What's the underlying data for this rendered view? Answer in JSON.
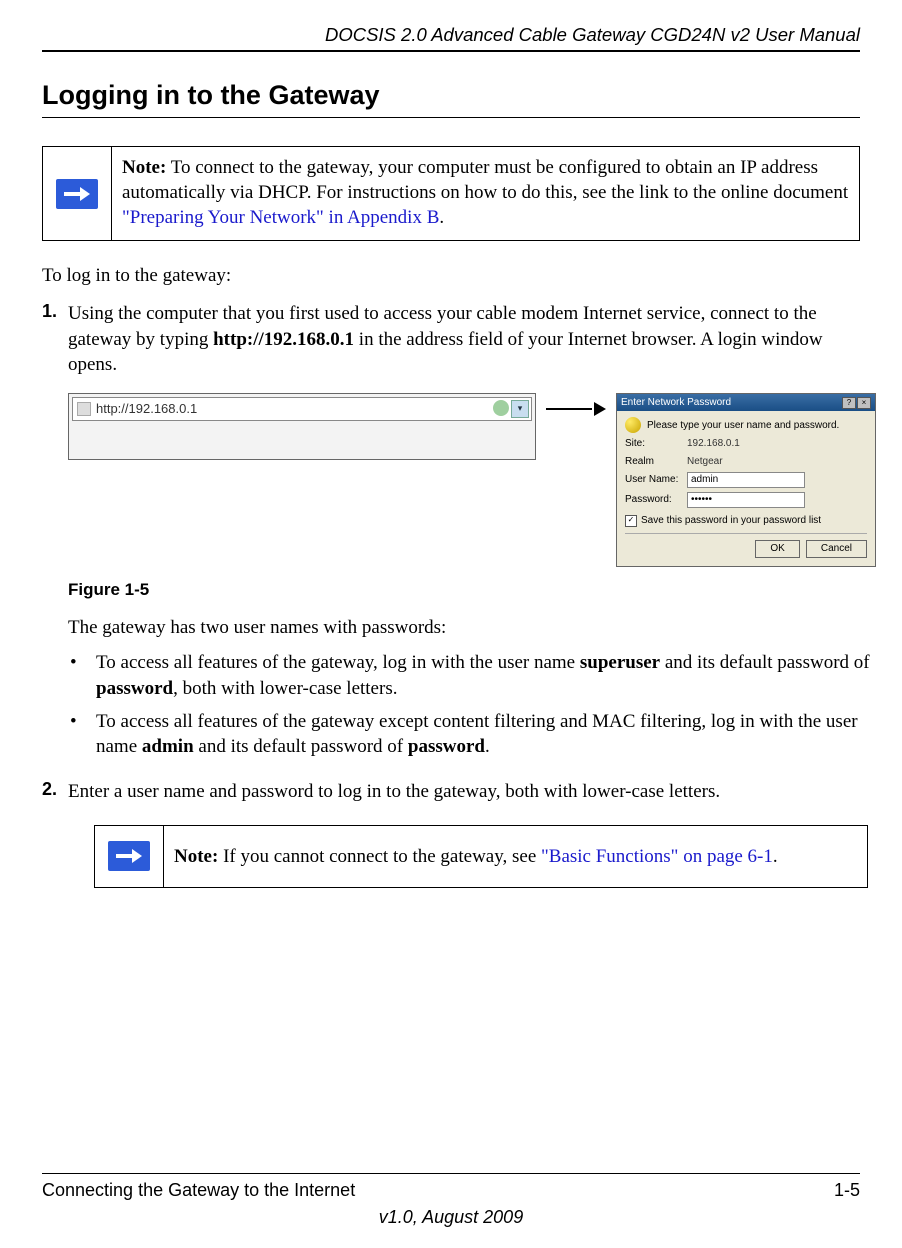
{
  "header": {
    "doc_title": "DOCSIS 2.0 Advanced Cable Gateway CGD24N v2 User Manual"
  },
  "section": {
    "title": "Logging in to the Gateway"
  },
  "note1": {
    "label": "Note:",
    "text_before_link": " To connect to the gateway, your computer must be configured to obtain an IP address automatically via DHCP. For instructions on how to do this, see the link to the online document ",
    "link_text": "\"Preparing Your Network\" in Appendix B",
    "after_link": "."
  },
  "intro": "To log in to the gateway:",
  "step1": {
    "num": "1.",
    "text_a": "Using the computer that you first used to access your cable modem Internet service, connect to the gateway by typing ",
    "bold_url": "http://192.168.0.1",
    "text_b": " in the address field of your Internet browser. A login window opens."
  },
  "addr_bar": {
    "url": "http://192.168.0.1"
  },
  "login_dialog": {
    "title": "Enter Network Password",
    "prompt": "Please type your user name and password.",
    "site_label": "Site:",
    "site_value": "192.168.0.1",
    "realm_label": "Realm",
    "realm_value": "Netgear",
    "user_label": "User Name:",
    "user_value": "admin",
    "pass_label": "Password:",
    "pass_value": "••••••",
    "save_label": "Save this password in your password list",
    "ok": "OK",
    "cancel": "Cancel"
  },
  "figure_caption": "Figure 1-5",
  "sub_intro": "The gateway has two user names with passwords:",
  "bullet1": {
    "a": "To access all features of the gateway, log in with the user name ",
    "b1": "superuser",
    "c": " and its default password of ",
    "b2": "password",
    "d": ", both with lower-case letters."
  },
  "bullet2": {
    "a": "To access all features of the gateway except content filtering and MAC filtering, log in with the user name ",
    "b1": "admin",
    "c": " and its default password of ",
    "b2": "password",
    "d": "."
  },
  "step2": {
    "num": "2.",
    "text": "Enter a user name and password to log in to the gateway, both with lower-case letters."
  },
  "note2": {
    "label": "Note:",
    "text_before_link": " If you cannot connect to the gateway, see ",
    "link_text": "\"Basic Functions\" on page 6-1",
    "after_link": "."
  },
  "footer": {
    "left": "Connecting the Gateway to the Internet",
    "right": "1-5",
    "version": "v1.0, August 2009"
  }
}
